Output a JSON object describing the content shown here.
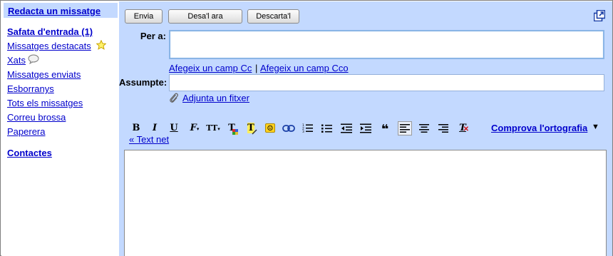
{
  "sidebar": {
    "compose_label": "Redacta un missatge",
    "items": [
      {
        "label": "Safata d'entrada (1)",
        "bold": true
      },
      {
        "label": "Missatges destacats"
      },
      {
        "label": "Xats"
      },
      {
        "label": "Missatges enviats"
      },
      {
        "label": "Esborranys"
      },
      {
        "label": "Tots els missatges"
      },
      {
        "label": "Correu brossa"
      },
      {
        "label": "Paperera"
      }
    ],
    "contacts_label": "Contactes"
  },
  "toolbar": {
    "send_label": "Envia",
    "save_label": "Desa'l ara",
    "discard_label": "Descarta'l"
  },
  "form": {
    "to_label": "Per a:",
    "to_value": "",
    "add_cc_label": "Afegeix un camp Cc",
    "separator": "|",
    "add_bcc_label": "Afegeix un camp Cco",
    "subject_label": "Assumpte:",
    "subject_value": "",
    "attach_label": "Adjunta un fitxer"
  },
  "editor": {
    "format_buttons": [
      "B",
      "I",
      "U",
      "F",
      "TT",
      "T",
      "T",
      "☺",
      "link",
      "numbered-list",
      "bulleted-list",
      "outdent",
      "indent",
      "quote",
      "align-left",
      "align-center",
      "align-right",
      "remove-format"
    ],
    "spellcheck_label": "Comprova l'ortografia",
    "plain_text_label": "« Text net",
    "body_value": ""
  },
  "colors": {
    "accent_blue": "#c3d9ff",
    "link": "#0000cc"
  }
}
